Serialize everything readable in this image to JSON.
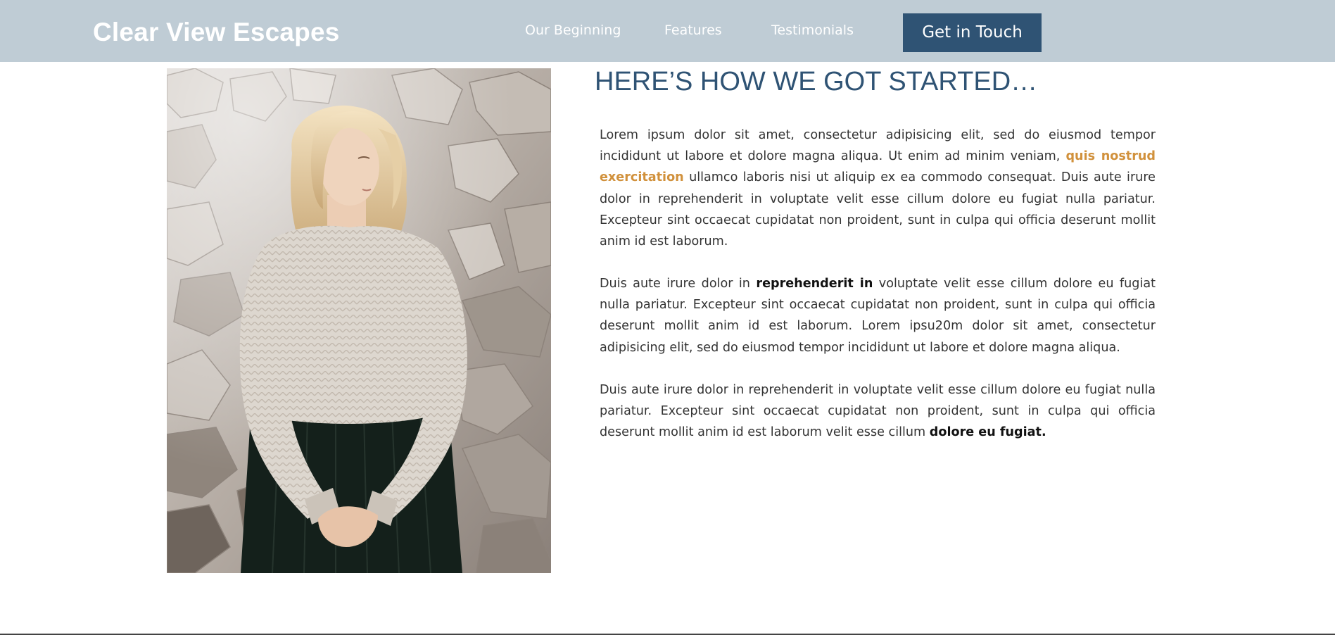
{
  "header": {
    "brand": "Clear View Escapes",
    "nav": [
      {
        "label": "Our Beginning"
      },
      {
        "label": "Features"
      },
      {
        "label": "Testimonials"
      }
    ],
    "cta_label": "Get in Touch"
  },
  "main": {
    "image_alt": "Woman in a knit sweater standing in front of rocks",
    "heading": "HERE’S HOW WE GOT STARTED…",
    "paragraphs": [
      {
        "before": "Lorem ipsum dolor sit amet, consectetur adipisicing elit, sed do eiusmod tempor incididunt ut labore et dolore magna aliqua. Ut enim ad minim veniam, ",
        "emphasis": "quis nostrud exercitation",
        "after": " ullamco laboris nisi ut aliquip ex ea commodo consequat. Duis aute irure dolor in reprehenderit in voluptate velit esse cillum dolore eu fugiat nulla pariatur. Excepteur sint occaecat cupidatat non proident, sunt in culpa qui officia deserunt mollit anim id est laborum."
      },
      {
        "before": "Duis aute irure dolor in ",
        "emphasis": "reprehenderit in",
        "after": " voluptate velit esse cillum dolore eu fugiat nulla pariatur. Excepteur sint occaecat cupidatat non proident, sunt in culpa qui officia deserunt mollit anim id est laborum. Lorem ipsu20m dolor sit amet, consectetur adipisicing elit, sed do eiusmod tempor incididunt ut labore et dolore magna aliqua."
      },
      {
        "before": "Duis aute irure dolor in reprehenderit in voluptate velit esse cillum dolore eu fugiat nulla pariatur. Excepteur sint occaecat cupidatat non proident, sunt in culpa qui officia deserunt mollit anim id est laborum velit esse cillum ",
        "emphasis": "dolore eu fugiat.",
        "after": ""
      }
    ]
  },
  "colors": {
    "navbar_bg": "#bfccd5",
    "brand_blue": "#2f5374",
    "accent_orange": "#d1913c",
    "body_text": "#333333"
  }
}
